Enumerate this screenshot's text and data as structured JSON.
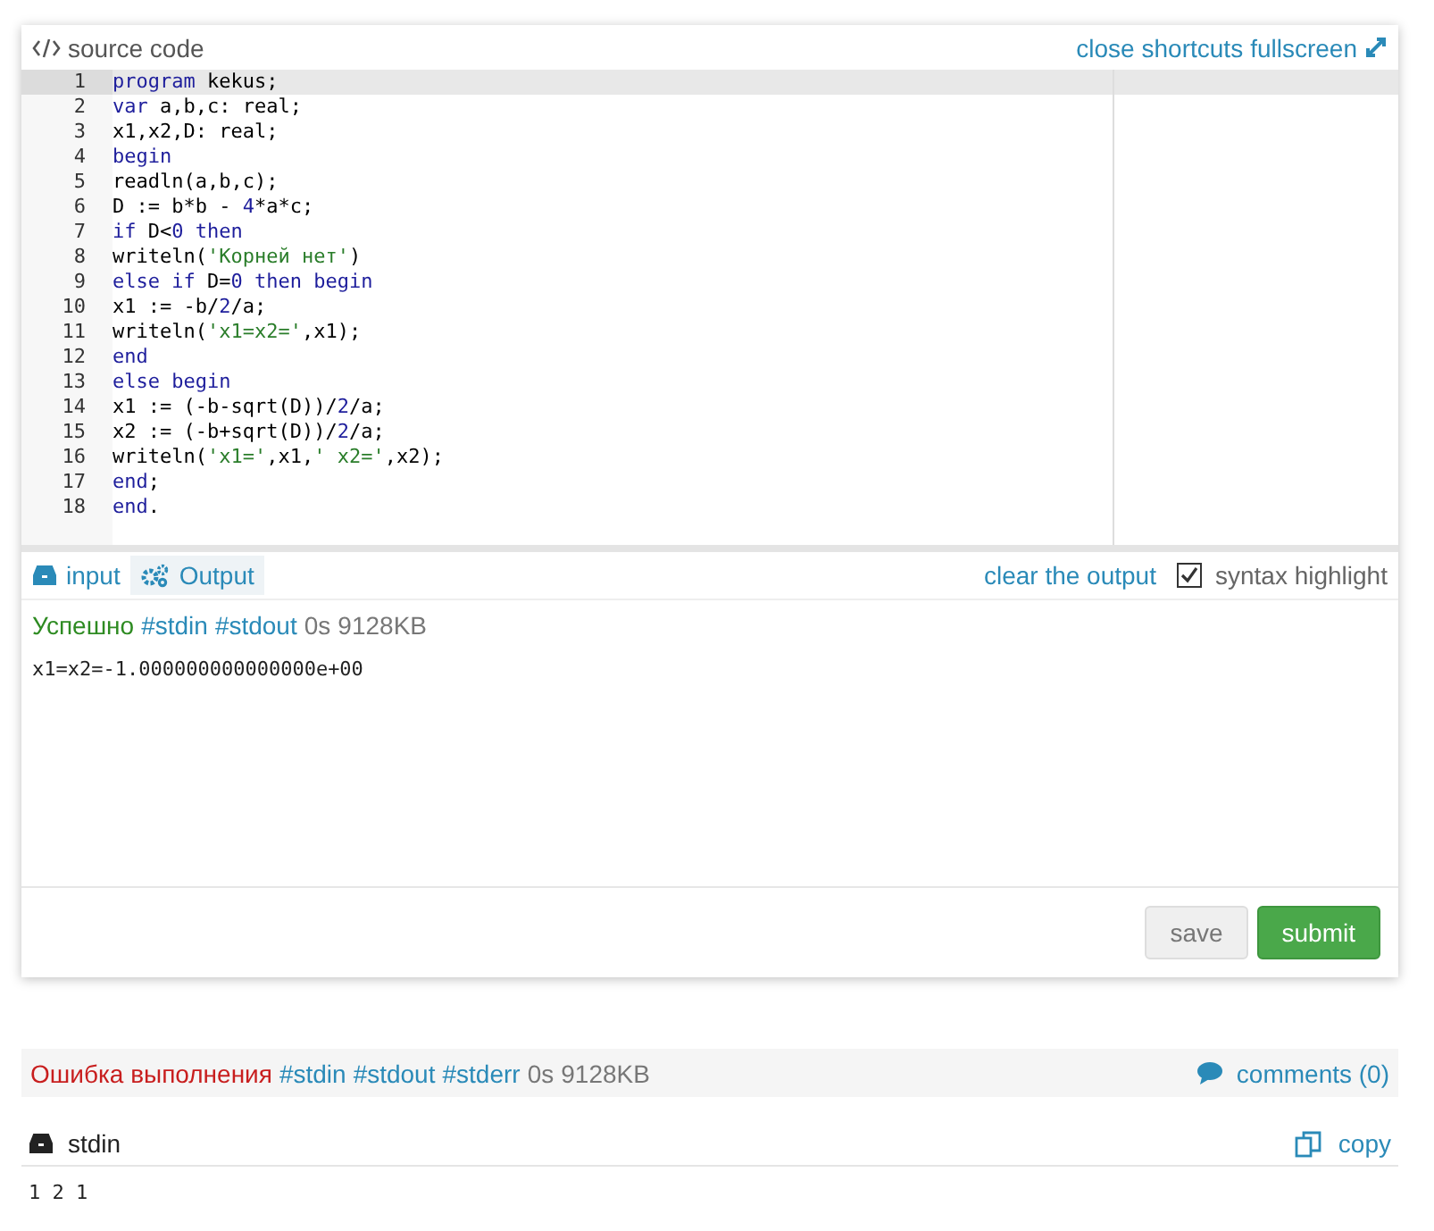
{
  "editor": {
    "title": "source code",
    "actions": [
      "close",
      "shortcuts",
      "fullscreen"
    ],
    "lines": [
      {
        "number": "1",
        "selected": true,
        "tokens": [
          {
            "kind": "kw",
            "t": "program"
          },
          {
            "kind": "txt",
            "t": " kekus;"
          }
        ]
      },
      {
        "number": "2",
        "selected": false,
        "tokens": [
          {
            "kind": "kw",
            "t": "var"
          },
          {
            "kind": "txt",
            "t": " a,b,c: real;"
          }
        ]
      },
      {
        "number": "3",
        "selected": false,
        "tokens": [
          {
            "kind": "txt",
            "t": "x1,x2,D: real;"
          }
        ]
      },
      {
        "number": "4",
        "selected": false,
        "tokens": [
          {
            "kind": "kw",
            "t": "begin"
          }
        ]
      },
      {
        "number": "5",
        "selected": false,
        "tokens": [
          {
            "kind": "txt",
            "t": "readln(a,b,c);"
          }
        ]
      },
      {
        "number": "6",
        "selected": false,
        "tokens": [
          {
            "kind": "txt",
            "t": "D := b*b - "
          },
          {
            "kind": "num",
            "t": "4"
          },
          {
            "kind": "txt",
            "t": "*a*c;"
          }
        ]
      },
      {
        "number": "7",
        "selected": false,
        "tokens": [
          {
            "kind": "kw",
            "t": "if"
          },
          {
            "kind": "txt",
            "t": " D<"
          },
          {
            "kind": "num",
            "t": "0"
          },
          {
            "kind": "kw",
            "t": " then"
          }
        ]
      },
      {
        "number": "8",
        "selected": false,
        "tokens": [
          {
            "kind": "txt",
            "t": "writeln("
          },
          {
            "kind": "str",
            "t": "'Корней нет'"
          },
          {
            "kind": "txt",
            "t": ")"
          }
        ]
      },
      {
        "number": "9",
        "selected": false,
        "tokens": [
          {
            "kind": "kw",
            "t": "else if"
          },
          {
            "kind": "txt",
            "t": " D="
          },
          {
            "kind": "num",
            "t": "0"
          },
          {
            "kind": "kw",
            "t": " then begin"
          }
        ]
      },
      {
        "number": "10",
        "selected": false,
        "tokens": [
          {
            "kind": "txt",
            "t": "x1 := -b/"
          },
          {
            "kind": "num",
            "t": "2"
          },
          {
            "kind": "txt",
            "t": "/a;"
          }
        ]
      },
      {
        "number": "11",
        "selected": false,
        "tokens": [
          {
            "kind": "txt",
            "t": "writeln("
          },
          {
            "kind": "str",
            "t": "'x1=x2='"
          },
          {
            "kind": "txt",
            "t": ",x1);"
          }
        ]
      },
      {
        "number": "12",
        "selected": false,
        "tokens": [
          {
            "kind": "kw",
            "t": "end"
          }
        ]
      },
      {
        "number": "13",
        "selected": false,
        "tokens": [
          {
            "kind": "kw",
            "t": "else begin"
          }
        ]
      },
      {
        "number": "14",
        "selected": false,
        "tokens": [
          {
            "kind": "txt",
            "t": "x1 := (-b-sqrt(D))/"
          },
          {
            "kind": "num",
            "t": "2"
          },
          {
            "kind": "txt",
            "t": "/a;"
          }
        ]
      },
      {
        "number": "15",
        "selected": false,
        "tokens": [
          {
            "kind": "txt",
            "t": "x2 := (-b+sqrt(D))/"
          },
          {
            "kind": "num",
            "t": "2"
          },
          {
            "kind": "txt",
            "t": "/a;"
          }
        ]
      },
      {
        "number": "16",
        "selected": false,
        "tokens": [
          {
            "kind": "txt",
            "t": "writeln("
          },
          {
            "kind": "str",
            "t": "'x1='"
          },
          {
            "kind": "txt",
            "t": ",x1,"
          },
          {
            "kind": "str",
            "t": "' x2='"
          },
          {
            "kind": "txt",
            "t": ",x2);"
          }
        ]
      },
      {
        "number": "17",
        "selected": false,
        "tokens": [
          {
            "kind": "kw",
            "t": "end"
          },
          {
            "kind": "txt",
            "t": ";"
          }
        ]
      },
      {
        "number": "18",
        "selected": false,
        "tokens": [
          {
            "kind": "kw",
            "t": "end"
          },
          {
            "kind": "txt",
            "t": "."
          }
        ]
      }
    ]
  },
  "tabs": [
    {
      "label": "input",
      "selected": false
    },
    {
      "label": "Output",
      "selected": true
    }
  ],
  "clear_output": "clear the output",
  "syntax_highlight": {
    "label": "syntax highlight",
    "checked": true
  },
  "output": {
    "status": "Успешно",
    "kind": "success",
    "tags": [
      "#stdin",
      "#stdout"
    ],
    "time": "0s",
    "memory": "9128KB",
    "text": "x1=x2=-1.000000000000000e+00"
  },
  "buttons": [
    {
      "label": "save",
      "kind": "default"
    },
    {
      "label": "submit",
      "kind": "primary"
    }
  ],
  "result": {
    "status": "Ошибка выполнения",
    "kind": "error",
    "tags": [
      "#stdin",
      "#stdout",
      "#stderr"
    ],
    "time": "0s",
    "memory": "9128KB",
    "comments": "comments (0)"
  },
  "stdin": {
    "title": "stdin",
    "copy": "copy",
    "text": "1 2 1"
  }
}
